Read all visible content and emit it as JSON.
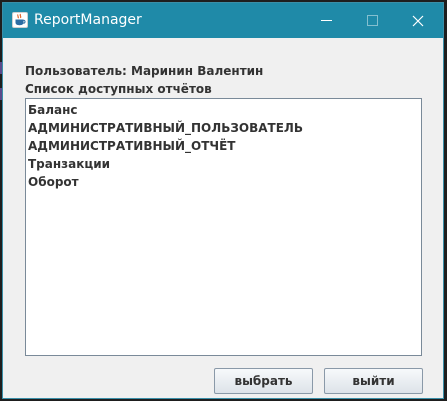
{
  "window": {
    "title": "ReportManager",
    "icon": "java-cup-icon",
    "controls": [
      "minimize-icon",
      "maximize-icon",
      "close-icon"
    ]
  },
  "user_label": "Пользователь: Маринин Валентин",
  "list_caption": "Список доступных отчётов",
  "reports": [
    "Баланс",
    "АДМИНИСТРАТИВНЫЙ_ПОЛЬЗОВАТЕЛЬ",
    "АДМИНИСТРАТИВНЫЙ_ОТЧЁТ",
    "Транзакции",
    "Оборот"
  ],
  "buttons": {
    "select_label": "выбрать",
    "exit_label": "выйти"
  },
  "colors": {
    "titlebar": "#1f8aa8",
    "window_bg": "#f0f0f0",
    "list_bg": "#ffffff",
    "text": "#333333"
  }
}
